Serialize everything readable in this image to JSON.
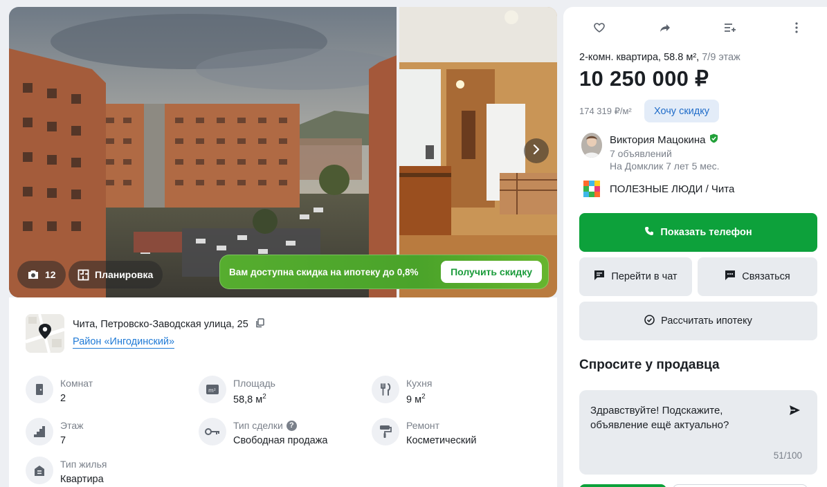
{
  "gallery": {
    "photo_count": "12",
    "plan_label": "Планировка",
    "promo_text": "Вам доступна скидка на ипотеку до 0,8%",
    "promo_button": "Получить скидку"
  },
  "location": {
    "address": "Чита, Петровско-Заводская улица, 25",
    "district": "Район «Ингодинский»"
  },
  "features": [
    {
      "label": "Комнат",
      "value": "2",
      "icon": "door-icon"
    },
    {
      "label": "Площадь",
      "value": "58,8 м",
      "sup": "2",
      "icon": "area-icon"
    },
    {
      "label": "Кухня",
      "value": "9 м",
      "sup": "2",
      "icon": "cutlery-icon"
    },
    {
      "label": "Этаж",
      "value": "7",
      "icon": "stairs-icon"
    },
    {
      "label": "Тип сделки",
      "value": "Свободная продажа",
      "icon": "key-icon",
      "help": "?"
    },
    {
      "label": "Ремонт",
      "value": "Косметический",
      "icon": "paint-roller-icon"
    },
    {
      "label": "Тип жилья",
      "value": "Квартира",
      "icon": "building-icon"
    }
  ],
  "listing": {
    "subtitle": "2-комн. квартира, 58.8 м², ",
    "floor": "7/9 этаж",
    "price": "10 250 000 ₽",
    "price_per_meter": "174 319 ₽/м²",
    "discount_button": "Хочу скидку"
  },
  "seller": {
    "name": "Виктория Мацокина",
    "ads": "7 объявлений",
    "since": "На Домклик 7 лет 5 мес.",
    "agency": "ПОЛЕЗНЫЕ ЛЮДИ / Чита"
  },
  "actions": {
    "phone": "Показать телефон",
    "chat": "Перейти в чат",
    "contact": "Связаться",
    "mortgage": "Рассчитать ипотеку"
  },
  "ask": {
    "title": "Спросите у продавца",
    "message": "Здравствуйте! Подскажите, объявление ещё актуально?",
    "counter": "51/100"
  },
  "colors": {
    "accent_green": "#0da13b",
    "link_blue": "#1f7ad6",
    "secondary_bg": "#e8ebef"
  }
}
